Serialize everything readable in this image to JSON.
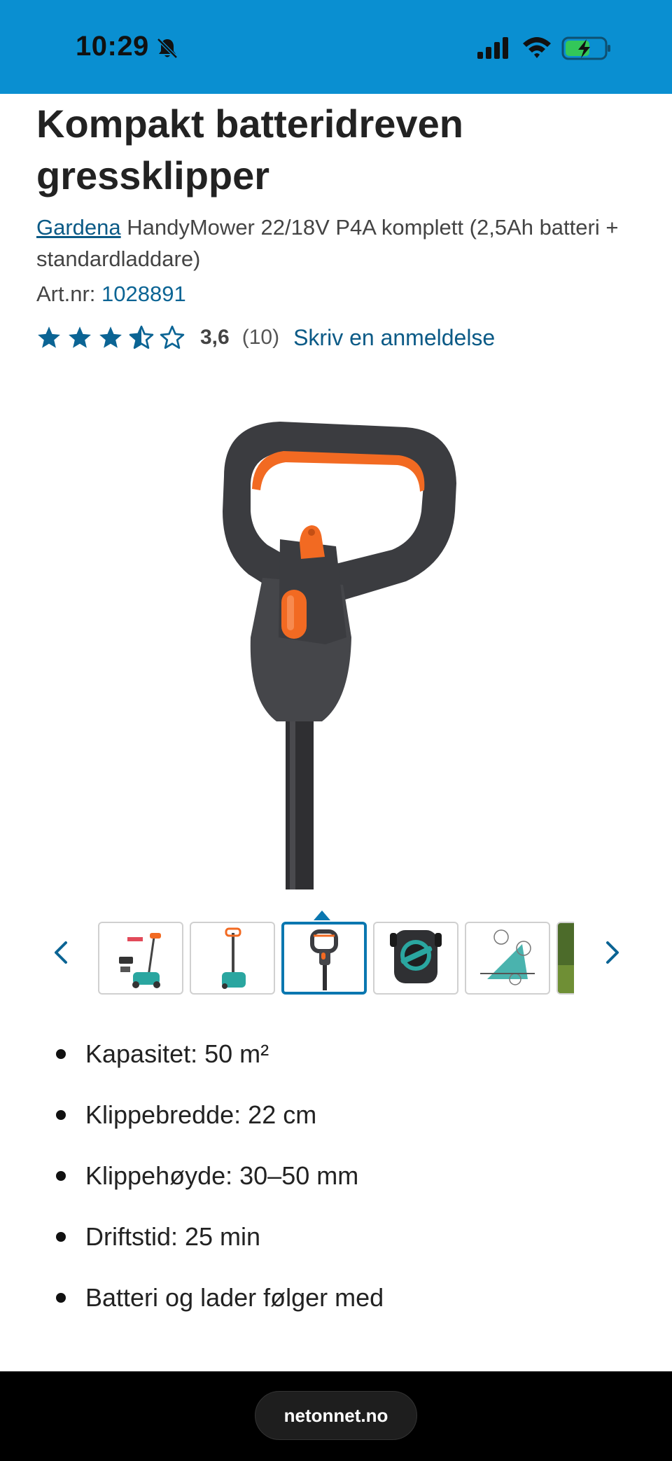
{
  "status_bar": {
    "time": "10:29",
    "background": "#0a8fd1",
    "icons": [
      "bell-muted-icon",
      "signal-icon",
      "wifi-icon",
      "battery-charging-icon"
    ]
  },
  "product": {
    "title": "Kompakt batteridreven gressklipper",
    "brand": "Gardena",
    "model": " HandyMower 22/18V P4A komplett (2,5Ah batteri + standardladdare)",
    "artnr_label": "Art.nr:",
    "artnr_value": "1028891"
  },
  "rating": {
    "value": "3,6",
    "count": "(10)",
    "stars_filled": 3.5,
    "stars_total": 5,
    "review_link": "Skriv en anmeldelse",
    "accent": "#0b6494"
  },
  "gallery": {
    "main_image": "mower-handle-image",
    "thumbnails": [
      "mower-kit-thumbnail",
      "mower-side-thumbnail",
      "mower-handle-thumbnail",
      "mower-underside-thumbnail",
      "cutting-height-diagram-thumbnail",
      "mower-in-garden-thumbnail"
    ],
    "active_index": 2
  },
  "features": [
    "Kapasitet: 50 m²",
    "Klippebredde: 22 cm",
    "Klippehøyde: 30–50 mm",
    "Driftstid: 25 min",
    "Batteri og lader følger med"
  ],
  "browser": {
    "url": "netonnet.no"
  }
}
